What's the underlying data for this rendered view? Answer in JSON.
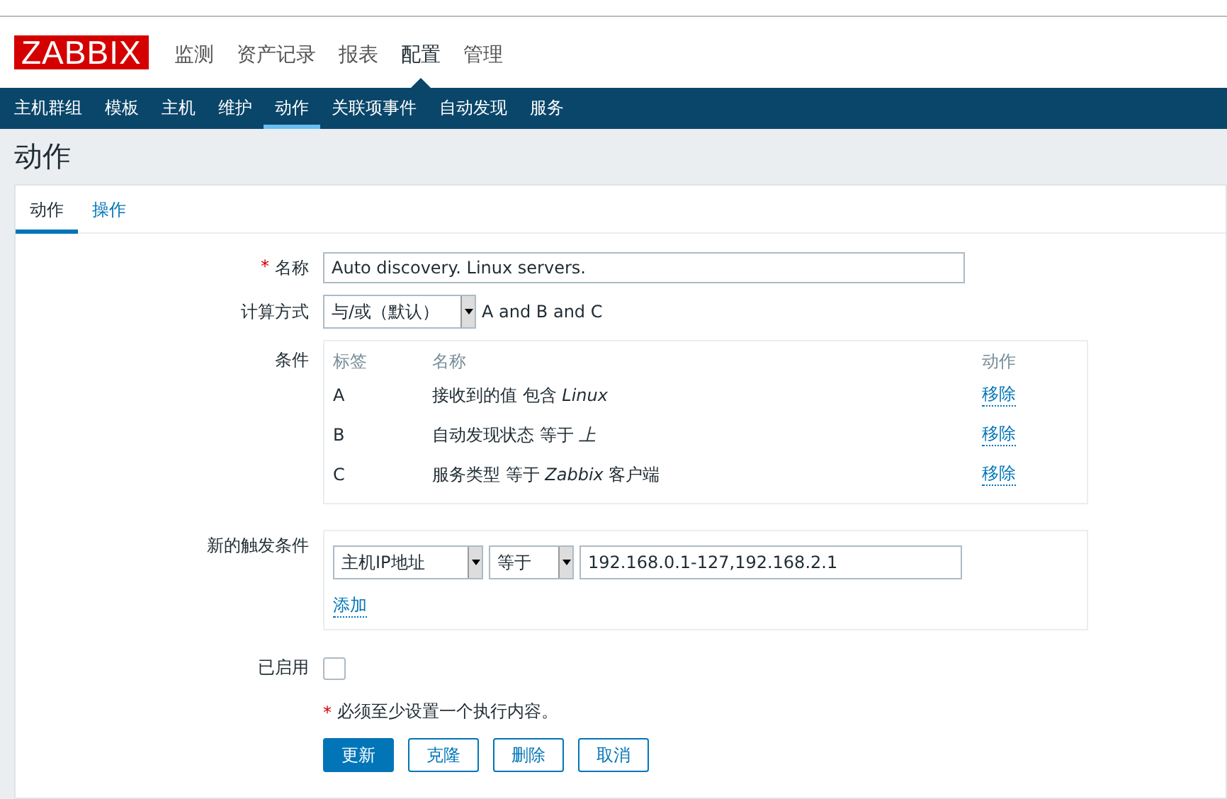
{
  "logo": "ZABBIX",
  "main_menu": [
    {
      "label": "监测",
      "selected": false
    },
    {
      "label": "资产记录",
      "selected": false
    },
    {
      "label": "报表",
      "selected": false
    },
    {
      "label": "配置",
      "selected": true
    },
    {
      "label": "管理",
      "selected": false
    }
  ],
  "sub_menu": [
    {
      "label": "主机群组",
      "selected": false
    },
    {
      "label": "模板",
      "selected": false
    },
    {
      "label": "主机",
      "selected": false
    },
    {
      "label": "维护",
      "selected": false
    },
    {
      "label": "动作",
      "selected": true
    },
    {
      "label": "关联项事件",
      "selected": false
    },
    {
      "label": "自动发现",
      "selected": false
    },
    {
      "label": "服务",
      "selected": false
    }
  ],
  "page_title": "动作",
  "tabs": [
    {
      "label": "动作",
      "selected": true
    },
    {
      "label": "操作",
      "selected": false
    }
  ],
  "form": {
    "required_mark": "*",
    "name_label": "名称",
    "name_value": "Auto discovery. Linux servers.",
    "calc_label": "计算方式",
    "calc_value": "与/或（默认）",
    "calc_formula": "A and B and C",
    "conditions_label": "条件",
    "conditions_columns": [
      "标签",
      "名称",
      "动作"
    ],
    "conditions": [
      {
        "label": "A",
        "name": "接收到的值 包含 *Linux*",
        "action": "移除"
      },
      {
        "label": "B",
        "name": "自动发现状态 等于 *上*",
        "action": "移除"
      },
      {
        "label": "C",
        "name": "服务类型 等于 *Zabbix* 客户端",
        "action": "移除"
      }
    ],
    "new_condition_label": "新的触发条件",
    "new_condition_type": "主机IP地址",
    "new_condition_operator": "等于",
    "new_condition_value": "192.168.0.1-127,192.168.2.1",
    "add_link": "添加",
    "enabled_label": "已启用",
    "enabled": false,
    "warning": "必须至少设置一个执行内容。",
    "buttons": [
      {
        "label": "更新",
        "kind": "primary"
      },
      {
        "label": "克隆",
        "kind": "secondary"
      },
      {
        "label": "删除",
        "kind": "secondary"
      },
      {
        "label": "取消",
        "kind": "secondary"
      }
    ]
  }
}
